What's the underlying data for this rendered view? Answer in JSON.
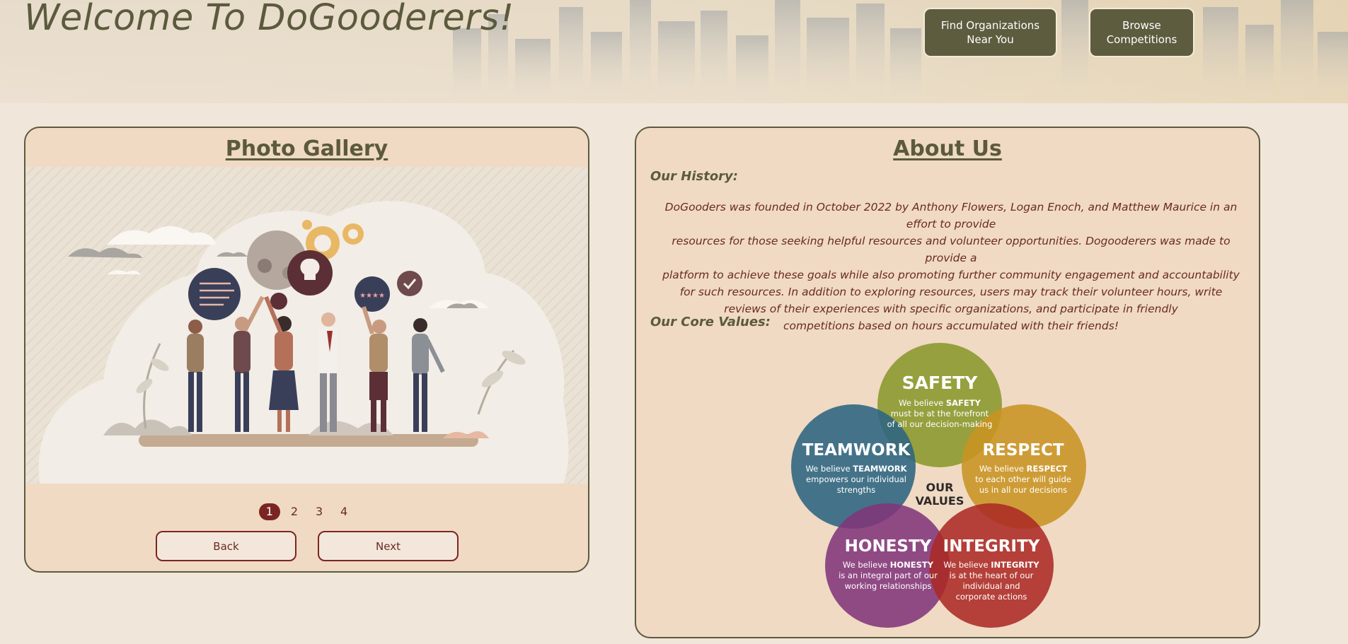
{
  "header": {
    "title": "Welcome To DoGooderers!",
    "buttons": {
      "find": "Find Organizations\nNear You",
      "browse": "Browse\nCompetitions"
    }
  },
  "gallery": {
    "title": "Photo Gallery",
    "pages": [
      "1",
      "2",
      "3",
      "4"
    ],
    "active_page": "1",
    "back_label": "Back",
    "next_label": "Next"
  },
  "about": {
    "title": "About Us",
    "history_heading": "Our History:",
    "history_lines": [
      "DoGooders was founded in October 2022 by Anthony Flowers, Logan Enoch, and Matthew Maurice in an effort to provide",
      "resources for those seeking helpful resources and volunteer opportunities. Dogooderers was made to provide a",
      "platform to achieve these goals while also promoting further community engagement and accountability",
      "for such resources. In addition to exploring resources, users may track their volunteer hours, write",
      "reviews of their experiences with specific organizations, and participate in friendly",
      "competitions based on hours accumulated with their friends!"
    ],
    "values_heading": "Our Core Values:",
    "values": {
      "center": [
        "OUR",
        "VALUES"
      ],
      "safety": {
        "title": "SAFETY",
        "pre": "We believe ",
        "bold": "SAFETY",
        "rest": [
          "must be at the forefront",
          "of all our decision-making"
        ],
        "color": "#93b239"
      },
      "teamwork": {
        "title": "TEAMWORK",
        "pre": "We believe ",
        "bold": "TEAMWORK",
        "rest": [
          "empowers our individual",
          "strengths"
        ],
        "color": "#2f76a8"
      },
      "respect": {
        "title": "RESPECT",
        "pre": "We believe ",
        "bold": "RESPECT",
        "rest": [
          "to each other will guide",
          "us in all our decisions"
        ],
        "color": "#d6ad2c"
      },
      "honesty": {
        "title": "HONESTY",
        "pre": "We believe ",
        "bold": "HONESTY",
        "rest": [
          "is an integral part of our",
          "working relationships"
        ],
        "color": "#8a3fa0"
      },
      "integrity": {
        "title": "INTEGRITY",
        "pre": "We believe ",
        "bold": "INTEGRITY",
        "rest": [
          "is at the heart of our",
          "individual and",
          "corporate actions"
        ],
        "color": "#b63131"
      }
    }
  },
  "colors": {
    "primary": "#5b5a3d",
    "accent": "#7b2523",
    "panel": "#f0dac3",
    "background": "#f0e6da"
  }
}
